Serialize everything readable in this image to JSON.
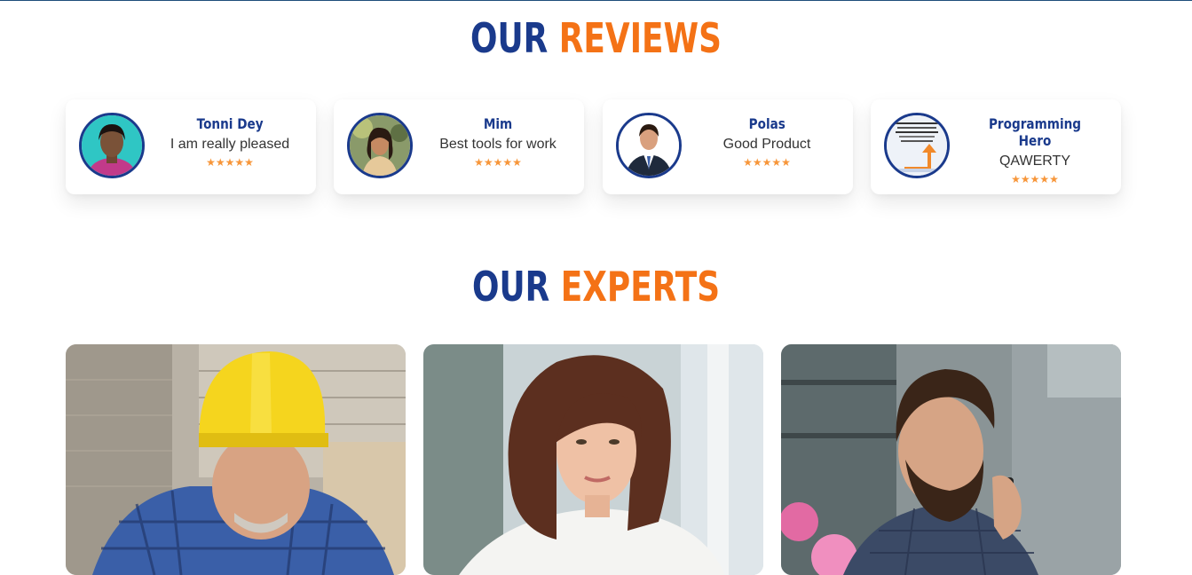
{
  "reviews_section": {
    "title_part1": "OUR",
    "title_part2": "REVIEWS",
    "items": [
      {
        "name": "Tonni Dey",
        "comment": "I am really pleased",
        "stars": "★★★★★",
        "rating": 5
      },
      {
        "name": "Mim",
        "comment": "Best tools for work",
        "stars": "★★★★★",
        "rating": 5
      },
      {
        "name": "Polas",
        "comment": "Good Product",
        "stars": "★★★★★",
        "rating": 5
      },
      {
        "name": "Programming Hero",
        "comment": "QAWERTY",
        "stars": "★★★★★",
        "rating": 5
      }
    ]
  },
  "experts_section": {
    "title_part1": "OUR",
    "title_part2": "EXPERTS",
    "items": [
      {
        "photo": "construction-worker-photo"
      },
      {
        "photo": "businesswoman-photo"
      },
      {
        "photo": "businessman-on-phone-photo"
      }
    ]
  },
  "colors": {
    "primary": "#1a3a8c",
    "accent": "#f47216",
    "star": "#f7963a"
  }
}
